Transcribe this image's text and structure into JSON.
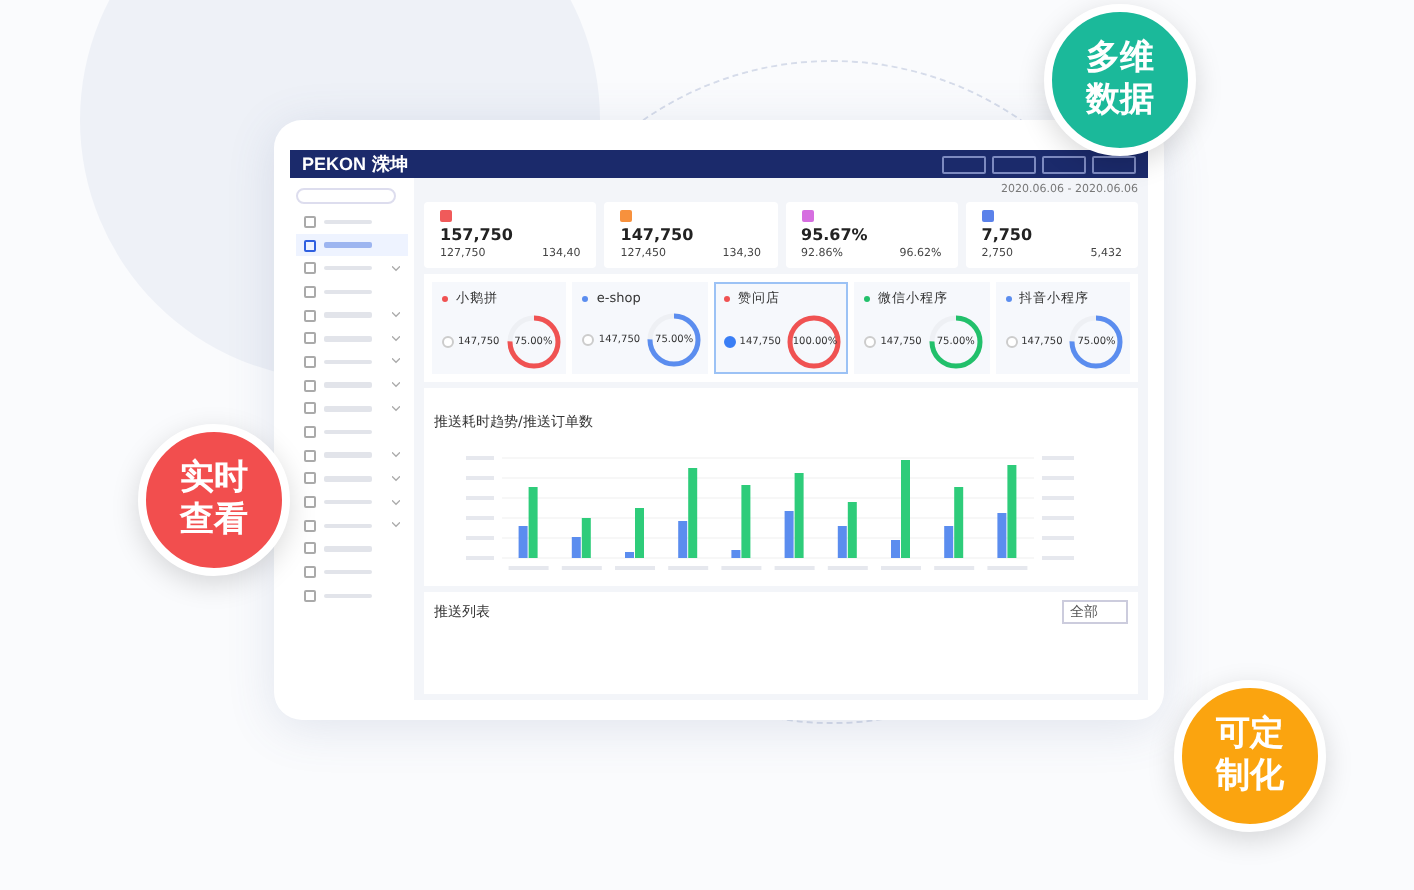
{
  "header": {
    "logo": "PEKON",
    "logo_cn": "溁坤"
  },
  "sidebar": {
    "items": [
      {
        "selected": false,
        "expandable": false
      },
      {
        "selected": true,
        "expandable": false
      },
      {
        "selected": false,
        "expandable": true
      },
      {
        "selected": false,
        "expandable": false
      },
      {
        "selected": false,
        "expandable": true
      },
      {
        "selected": false,
        "expandable": true
      },
      {
        "selected": false,
        "expandable": true
      },
      {
        "selected": false,
        "expandable": true
      },
      {
        "selected": false,
        "expandable": true
      },
      {
        "selected": false,
        "expandable": false
      },
      {
        "selected": false,
        "expandable": true
      },
      {
        "selected": false,
        "expandable": true
      },
      {
        "selected": false,
        "expandable": true
      },
      {
        "selected": false,
        "expandable": true
      },
      {
        "selected": false,
        "expandable": false
      },
      {
        "selected": false,
        "expandable": false
      },
      {
        "selected": false,
        "expandable": false
      }
    ]
  },
  "filter": {
    "date_range": "2020.06.06 - 2020.06.06"
  },
  "stats": [
    {
      "value": "157,750",
      "color": "#f05a5a",
      "sub": [
        "127,750",
        "134,40"
      ]
    },
    {
      "value": "147,750",
      "color": "#f7913d",
      "sub": [
        "127,450",
        "134,30"
      ]
    },
    {
      "value": "95.67%",
      "color": "#d66ee0",
      "sub": [
        "92.86%",
        "96.62%"
      ]
    },
    {
      "value": "7,750",
      "color": "#5b82ea",
      "sub": [
        "2,750",
        "5,432"
      ]
    }
  ],
  "channels": [
    {
      "name": "小鹅拼",
      "color": "#f05252",
      "selected": false,
      "orders": "147,750",
      "percent": "75.00%"
    },
    {
      "name": "e-shop",
      "color": "#5b8def",
      "selected": false,
      "orders": "147,750",
      "percent": "75.00%"
    },
    {
      "name": "赞问店",
      "color": "#f05252",
      "selected": true,
      "orders": "147,750",
      "percent": "100.00%"
    },
    {
      "name": "微信小程序",
      "color": "#22c06b",
      "selected": false,
      "orders": "147,750",
      "percent": "75.00%"
    },
    {
      "name": "抖音小程序",
      "color": "#5b8def",
      "selected": false,
      "orders": "147,750",
      "percent": "75.00%"
    }
  ],
  "chart": {
    "title": "推送耗时趋势/推送订单数"
  },
  "table": {
    "title": "推送列表",
    "filter_value": "全部"
  },
  "badges": [
    {
      "text": "多维数据",
      "color": "#1bb99a"
    },
    {
      "text": "实时查看",
      "color": "#f24e4e"
    },
    {
      "text": "可定制化",
      "color": "#fba40f"
    }
  ]
}
